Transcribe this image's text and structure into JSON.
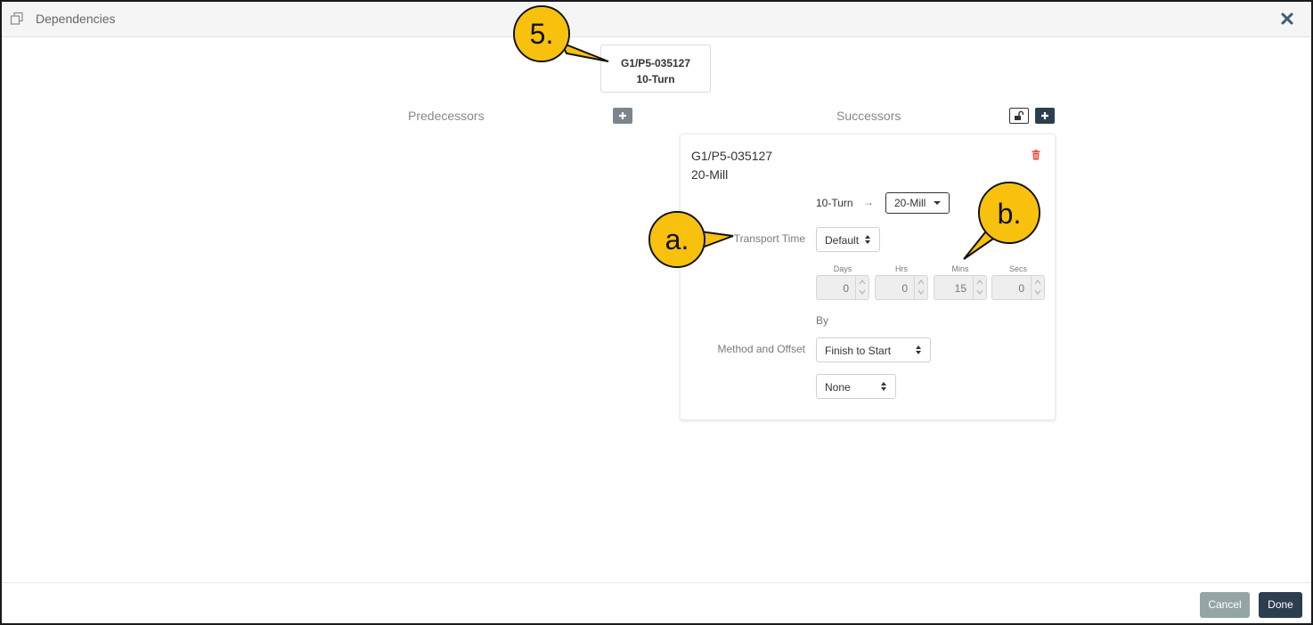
{
  "window": {
    "title": "Dependencies"
  },
  "source": {
    "line1": "G1/P5-035127",
    "line2": "10-Turn"
  },
  "columns": {
    "predecessors": "Predecessors",
    "successors": "Successors"
  },
  "successor": {
    "name_line1": "G1/P5-035127",
    "name_line2": "20-Mill",
    "flow_from": "10-Turn",
    "flow_arrow": "→",
    "flow_to_selected": "20-Mill",
    "transport_label": "Transport Time",
    "transport_selected": "Default",
    "duration": {
      "days_label": "Days",
      "days": "0",
      "hrs_label": "Hrs",
      "hrs": "0",
      "mins_label": "Mins",
      "mins": "15",
      "secs_label": "Secs",
      "secs": "0"
    },
    "by_label": "By",
    "method_label": "Method and Offset",
    "method_selected": "Finish to Start",
    "offset_selected": "None"
  },
  "footer": {
    "cancel_label": "Cancel",
    "done_label": "Done"
  },
  "callouts": {
    "five": "5.",
    "a": "a.",
    "b": "b."
  },
  "colors": {
    "callout_fill": "#f7c10e",
    "primary": "#2c3e50",
    "secondary": "#95a5a6",
    "plus_gray": "#7d858c",
    "danger": "#e74c3c"
  }
}
